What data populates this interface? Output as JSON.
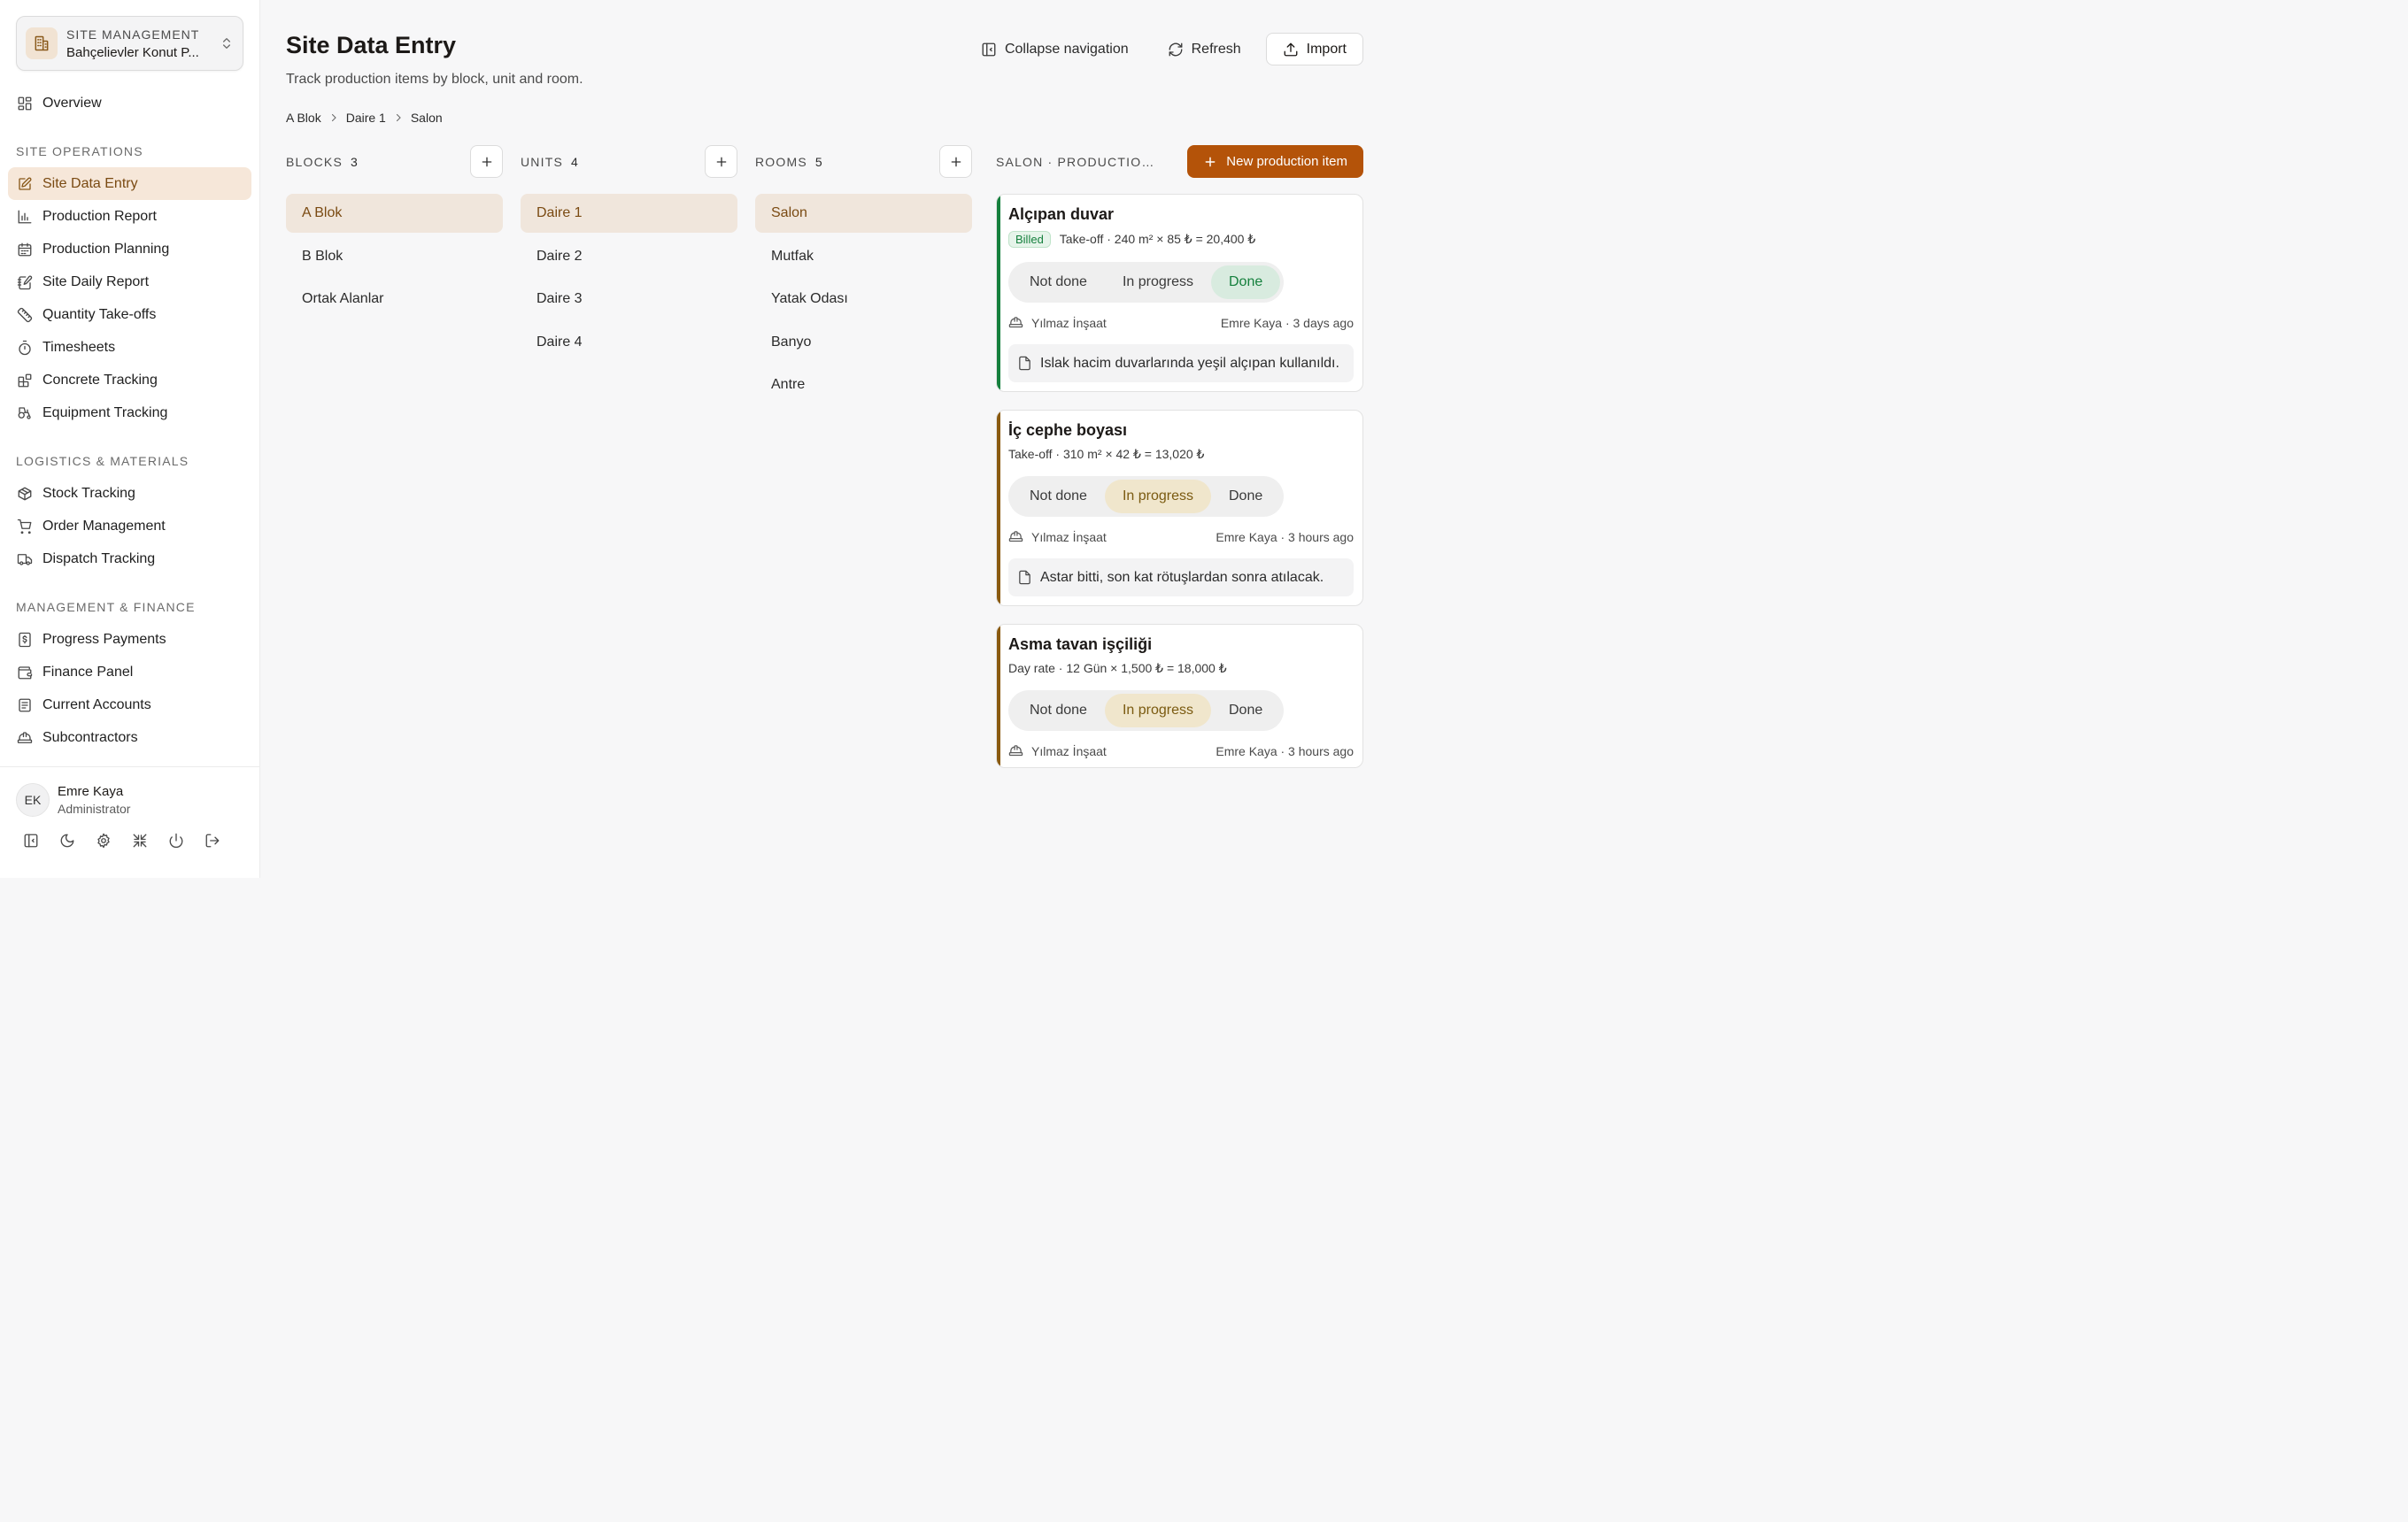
{
  "colors": {
    "accent": "#b45309",
    "selected_bg": "#f0e6dc",
    "done_green": "#15803d",
    "progress_brown": "#8a5a10"
  },
  "sidebar": {
    "switcher": {
      "kicker": "SITE MANAGEMENT",
      "name": "Bahçelievler Konut P..."
    },
    "overview": {
      "label": "Overview",
      "icon": "grid-icon"
    },
    "sections": [
      {
        "title": "SITE OPERATIONS",
        "items": [
          {
            "label": "Site Data Entry",
            "icon": "edit-icon"
          },
          {
            "label": "Production Report",
            "icon": "bar-chart-icon"
          },
          {
            "label": "Production Planning",
            "icon": "calendar-icon"
          },
          {
            "label": "Site Daily Report",
            "icon": "notebook-pen-icon"
          },
          {
            "label": "Quantity Take-offs",
            "icon": "ruler-icon"
          },
          {
            "label": "Timesheets",
            "icon": "stopwatch-icon"
          },
          {
            "label": "Concrete Tracking",
            "icon": "blocks-icon"
          },
          {
            "label": "Equipment Tracking",
            "icon": "tractor-icon"
          }
        ]
      },
      {
        "title": "LOGISTICS & MATERIALS",
        "items": [
          {
            "label": "Stock Tracking",
            "icon": "package-icon"
          },
          {
            "label": "Order Management",
            "icon": "cart-icon"
          },
          {
            "label": "Dispatch Tracking",
            "icon": "truck-icon"
          }
        ]
      },
      {
        "title": "MANAGEMENT & FINANCE",
        "items": [
          {
            "label": "Progress Payments",
            "icon": "receipt-icon"
          },
          {
            "label": "Finance Panel",
            "icon": "wallet-icon"
          },
          {
            "label": "Current Accounts",
            "icon": "ledger-icon"
          },
          {
            "label": "Subcontractors",
            "icon": "hard-hat-icon"
          }
        ]
      }
    ],
    "user": {
      "initials": "EK",
      "name": "Emre Kaya",
      "role": "Administrator"
    }
  },
  "header": {
    "title": "Site Data Entry",
    "subtitle": "Track production items by block, unit and room.",
    "collapse_label": "Collapse navigation",
    "refresh_label": "Refresh",
    "import_label": "Import"
  },
  "breadcrumb": [
    "A Blok",
    "Daire 1",
    "Salon"
  ],
  "columns": {
    "blocks": {
      "label": "BLOCKS",
      "count": "3",
      "items": [
        "A Blok",
        "B Blok",
        "Ortak Alanlar"
      ]
    },
    "units": {
      "label": "UNITS",
      "count": "4",
      "items": [
        "Daire 1",
        "Daire 2",
        "Daire 3",
        "Daire 4"
      ]
    },
    "rooms": {
      "label": "ROOMS",
      "count": "5",
      "items": [
        "Salon",
        "Mutfak",
        "Yatak Odası",
        "Banyo",
        "Antre"
      ]
    }
  },
  "items_panel": {
    "label": "SALON · PRODUCTION ITEMS",
    "new_button": "New production item",
    "status_options": [
      "Not done",
      "In progress",
      "Done"
    ],
    "cards": [
      {
        "title": "Alçıpan duvar",
        "badge": "Billed",
        "calc": "Take-off · 240 m² × 85 ₺ = 20,400 ₺",
        "status": "Done",
        "contractor": "Yılmaz İnşaat",
        "updated": "Emre Kaya · 3 days ago",
        "note": "Islak hacim duvarlarında yeşil alçıpan kullanıldı."
      },
      {
        "title": "İç cephe boyası",
        "calc": "Take-off · 310 m² × 42 ₺ = 13,020 ₺",
        "status": "In progress",
        "contractor": "Yılmaz İnşaat",
        "updated": "Emre Kaya · 3 hours ago",
        "note": "Astar bitti, son kat rötuşlardan sonra atılacak."
      },
      {
        "title": "Asma tavan işçiliği",
        "calc": "Day rate · 12 Gün × 1,500 ₺ = 18,000 ₺",
        "status": "In progress",
        "contractor": "Yılmaz İnşaat",
        "updated": "Emre Kaya · 3 hours ago"
      }
    ]
  }
}
